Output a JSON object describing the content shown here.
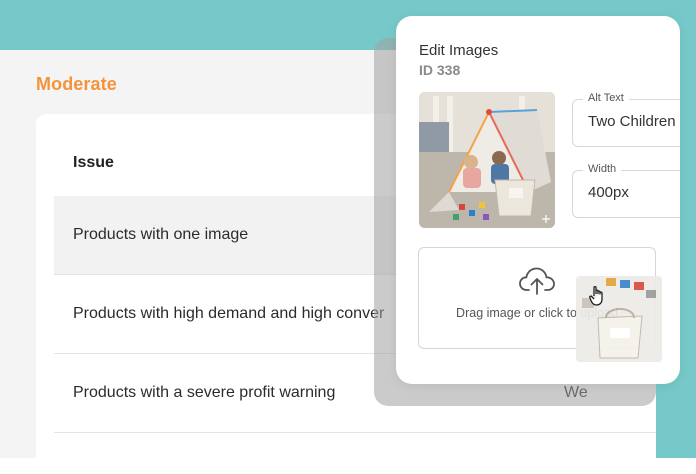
{
  "section": {
    "title": "Moderate"
  },
  "table": {
    "header": "Issue",
    "rows": [
      {
        "issue": "Products with one image"
      },
      {
        "issue": "Products with high demand and high conver"
      },
      {
        "issue": "Products with a severe profit warning",
        "extra": "We"
      }
    ]
  },
  "modal": {
    "title": "Edit Images",
    "id": "ID 338",
    "alt_text": {
      "label": "Alt Text",
      "value": "Two Children"
    },
    "width": {
      "label": "Width",
      "value": "400px"
    },
    "upload_text": "Drag image or click to upload"
  },
  "icons": {
    "upload": "cloud-upload-icon",
    "cursor": "hand-pointer-icon",
    "expand": "expand-icon"
  },
  "colors": {
    "accent_teal": "#76c9c8",
    "section_orange": "#f4933a"
  }
}
